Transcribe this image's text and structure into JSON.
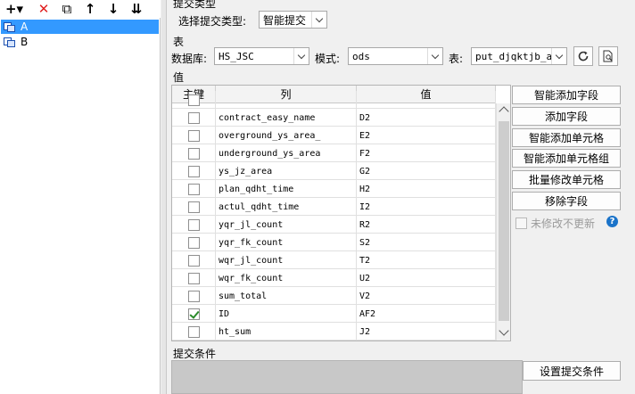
{
  "toolbar": {
    "items": [
      {
        "name": "add-icon",
        "glyph": "+▾"
      },
      {
        "name": "delete-icon",
        "glyph": "✕"
      },
      {
        "name": "copy-icon",
        "glyph": "⧉"
      },
      {
        "name": "move-up-icon",
        "glyph": "↑"
      },
      {
        "name": "move-down-icon",
        "glyph": "↓"
      },
      {
        "name": "sort-icon",
        "glyph": "⇊"
      }
    ]
  },
  "tree": {
    "items": [
      {
        "label": "A",
        "selected": true
      },
      {
        "label": "B",
        "selected": false
      }
    ]
  },
  "submit_type": {
    "section_title": "提交类型",
    "label": "选择提交类型:",
    "value": "智能提交"
  },
  "table_section": {
    "title": "表",
    "database_label": "数据库:",
    "database_value": "HS_JSC",
    "schema_label": "模式:",
    "schema_value": "ods",
    "table_label": "表:",
    "table_value": "put_djqktjb_a",
    "refresh_icon": "refresh-icon",
    "preview_icon": "preview-icon"
  },
  "values_section": {
    "title": "值",
    "columns": [
      "主键",
      "列",
      "值"
    ],
    "rows": [
      {
        "pk": false,
        "col": "contract_easy_name",
        "val": "D2"
      },
      {
        "pk": false,
        "col": "overground_ys_area_",
        "val": "E2"
      },
      {
        "pk": false,
        "col": "underground_ys_area",
        "val": "F2"
      },
      {
        "pk": false,
        "col": "ys_jz_area",
        "val": "G2"
      },
      {
        "pk": false,
        "col": "plan_qdht_time",
        "val": "H2"
      },
      {
        "pk": false,
        "col": "actul_qdht_time",
        "val": "I2"
      },
      {
        "pk": false,
        "col": "yqr_jl_count",
        "val": "R2"
      },
      {
        "pk": false,
        "col": "yqr_fk_count",
        "val": "S2"
      },
      {
        "pk": false,
        "col": "wqr_jl_count",
        "val": "T2"
      },
      {
        "pk": false,
        "col": "wqr_fk_count",
        "val": "U2"
      },
      {
        "pk": false,
        "col": "sum_total",
        "val": "V2"
      },
      {
        "pk": true,
        "col": "ID",
        "val": "AF2"
      },
      {
        "pk": false,
        "col": "ht_sum",
        "val": "J2"
      }
    ]
  },
  "actions": {
    "smart_add_field": "智能添加字段",
    "add_field": "添加字段",
    "smart_add_cell": "智能添加单元格",
    "smart_add_cell_group": "智能添加单元格组",
    "batch_modify_cell": "批量修改单元格",
    "remove_field": "移除字段",
    "no_update_unmodified": "未修改不更新",
    "help_glyph": "?"
  },
  "conditions": {
    "title": "提交条件",
    "set_button": "设置提交条件"
  },
  "colors": {
    "selection": "#3399ff",
    "help": "#1a73c9",
    "delete": "#e02020",
    "check": "#2a8a2a"
  }
}
